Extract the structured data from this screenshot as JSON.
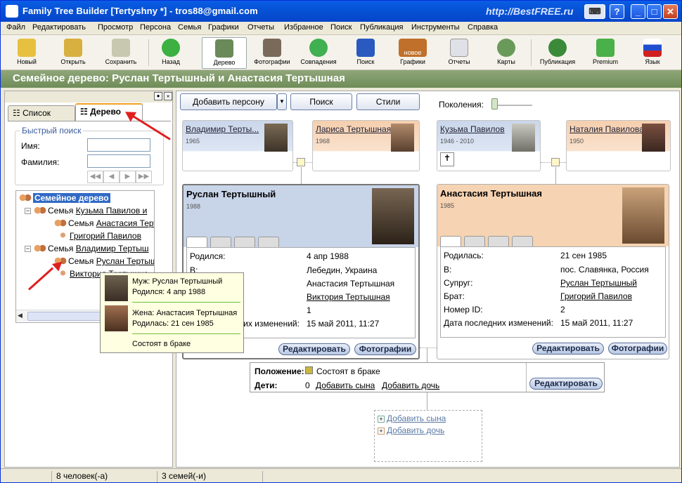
{
  "window": {
    "title": "Family Tree Builder [Tertyshny *] - tros88@gmail.com",
    "watermark": "http://BestFREE.ru"
  },
  "menu": [
    "Файл",
    "Редактировать",
    "Просмотр",
    "Персона",
    "Семья",
    "Графики",
    "Отчеты",
    "Избранное",
    "Поиск",
    "Публикация",
    "Инструменты",
    "Справка"
  ],
  "toolbar": [
    "Новый",
    "Открыть",
    "Сохранить",
    "Назад",
    "Дерево",
    "Фотографии",
    "Совпадения",
    "Поиск",
    "Графики",
    "Отчеты",
    "Карты",
    "Публикация",
    "Premium",
    "Язык"
  ],
  "toolbar_badge": "новое",
  "banner": "Семейное дерево: Руслан Тертышный и Анастасия Тертышная",
  "left": {
    "tab_list": "Список",
    "tab_tree": "Дерево",
    "quick_search": "Быстрый поиск",
    "first_name": "Имя:",
    "last_name": "Фамилия:",
    "tree": {
      "root": "Семейное дерево",
      "n1": "Семья",
      "n1_link": "Кузьма Павилов и",
      "n2": "Семья",
      "n2_link": "Анастасия Терты",
      "n3_link": "Григорий Павилов",
      "n4": "Семья",
      "n4_link": "Владимир Тертыш",
      "n5": "Семья",
      "n5_link": "Руслан Тертыш",
      "n6_link": "Виктория Тертышна"
    }
  },
  "tooltip": {
    "husband_label": "Муж:",
    "husband": "Руслан Тертышный",
    "husband_born": "Родился: 4 апр 1988",
    "wife_label": "Жена:",
    "wife": "Анастасия Тертышная",
    "wife_born": "Родилась: 21 сен 1985",
    "status": "Состоят в браке"
  },
  "main": {
    "add_person": "Добавить персону",
    "search": "Поиск",
    "styles": "Стили",
    "generations": "Поколения:",
    "parents": [
      {
        "name": "Владимир Терты...",
        "years": "1965"
      },
      {
        "name": "Лариса Тертышная",
        "years": "1968"
      },
      {
        "name": "Кузьма Павилов",
        "years": "1946 - 2010"
      },
      {
        "name": "Наталия Павилова",
        "years": "1950"
      }
    ],
    "husband": {
      "name": "Руслан Тертышный",
      "year": "1988",
      "rows": [
        {
          "l": "Родился:",
          "v": "4 апр 1988"
        },
        {
          "l": "В:",
          "v": "Лебедин, Украина"
        },
        {
          "l": "",
          "v": "Анастасия Тертышная"
        },
        {
          "l": "",
          "v": "Виктория Тертышная"
        },
        {
          "l": "",
          "v": "1"
        },
        {
          "l": "Дата последних изменений:",
          "v": "15 май 2011, 11:27"
        }
      ],
      "edit": "Редактировать",
      "photos": "Фотографии"
    },
    "wife": {
      "name": "Анастасия Тертышная",
      "year": "1985",
      "rows": [
        {
          "l": "Родилась:",
          "v": "21 сен 1985"
        },
        {
          "l": "В:",
          "v": "пос. Славянка, Россия"
        },
        {
          "l": "Супруг:",
          "v": "Руслан Тертышный"
        },
        {
          "l": "Брат:",
          "v": "Григорий Павилов"
        },
        {
          "l": "Номер ID:",
          "v": "2"
        },
        {
          "l": "Дата последних изменений:",
          "v": "15 май 2011, 11:27"
        }
      ],
      "edit": "Редактировать",
      "photos": "Фотографии"
    },
    "family": {
      "status_label": "Положение:",
      "status": "Состоят в браке",
      "children_label": "Дети:",
      "children_count": "0",
      "add_son": "Добавить сына",
      "add_daughter": "Добавить дочь",
      "edit": "Редактировать"
    },
    "add_box": {
      "son": "Добавить сына",
      "daughter": "Добавить дочь"
    }
  },
  "status": {
    "people": "8 человек(-а)",
    "families": "3 семей(-и)"
  }
}
